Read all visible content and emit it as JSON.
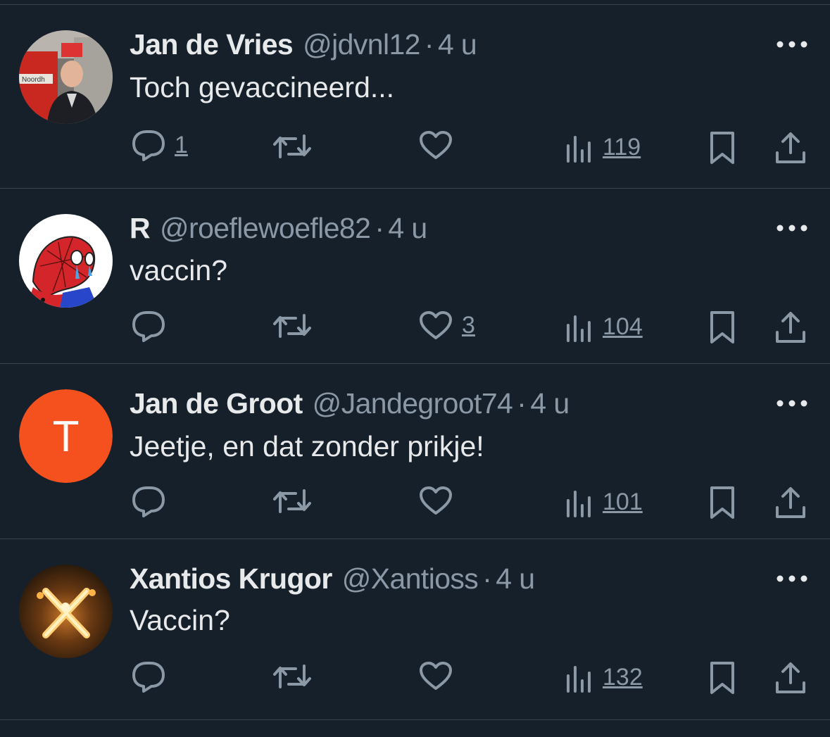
{
  "tweets": [
    {
      "name": "Jan de Vries",
      "handle": "@jdvnl12",
      "separator": "·",
      "time": "4 u",
      "text": "Toch gevaccineerd...",
      "replies": "1",
      "retweets": "",
      "likes": "",
      "views": "119",
      "avatar_icon": "person-photo-icon",
      "avatar_label": "Noordh"
    },
    {
      "name": "R",
      "handle": "@roeflewoefle82",
      "separator": "·",
      "time": "4 u",
      "text": "vaccin?",
      "replies": "",
      "retweets": "",
      "likes": "3",
      "views": "104",
      "avatar_icon": "crying-spiderman-icon"
    },
    {
      "name": "Jan de Groot",
      "handle": "@Jandegroot74",
      "separator": "·",
      "time": "4 u",
      "text": "Jeetje, en dat zonder prikje!",
      "replies": "",
      "retweets": "",
      "likes": "",
      "views": "101",
      "avatar_letter": "T",
      "avatar_color": "#f4511e"
    },
    {
      "name": "Xantios Krugor",
      "handle": "@Xantioss",
      "separator": "·",
      "time": "4 u",
      "text": "Vaccin?",
      "replies": "",
      "retweets": "",
      "likes": "",
      "views": "132",
      "avatar_icon": "fiery-x-icon"
    }
  ],
  "colors": {
    "background": "#15202b",
    "divider": "#38444d",
    "primary_text": "#e7e9ea",
    "secondary_text": "#8b98a5"
  }
}
